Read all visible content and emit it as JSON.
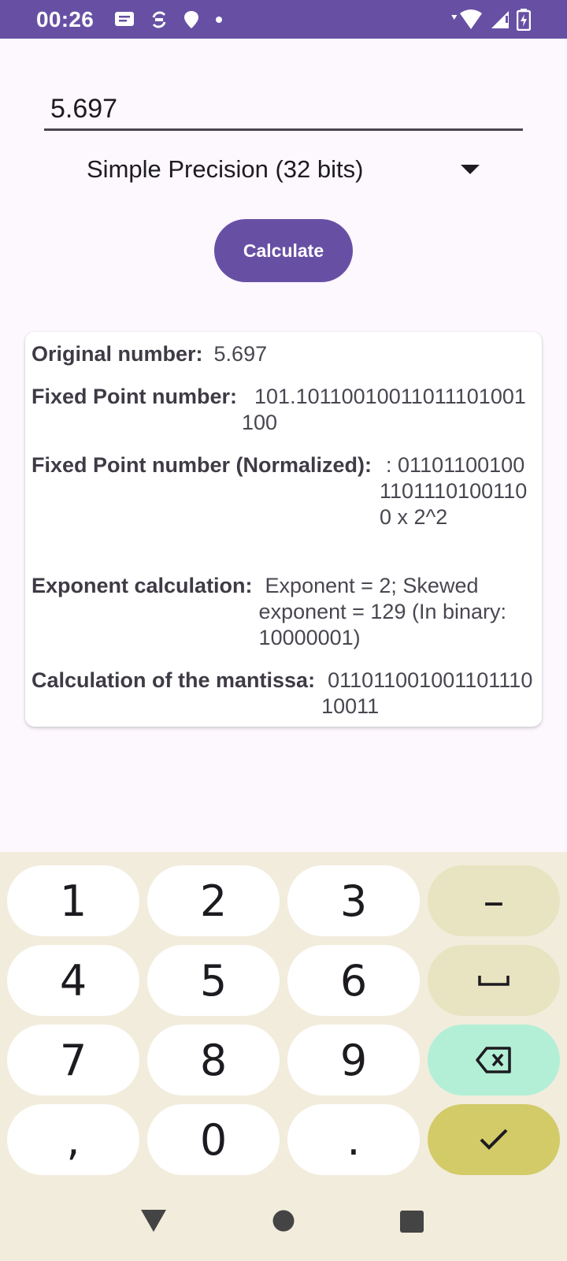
{
  "status_bar": {
    "time": "00:26",
    "left_icons": [
      "message-icon",
      "sync-icon",
      "location-icon",
      "dot-icon"
    ],
    "right_icons": [
      "wifi-icon",
      "cell-signal-icon",
      "battery-charging-icon"
    ]
  },
  "input": {
    "value": "5.697",
    "placeholder": ""
  },
  "precision": {
    "selected": "Simple Precision (32 bits)"
  },
  "calculate_button": {
    "label": "Calculate"
  },
  "results": {
    "original": {
      "label": "Original number:",
      "value": "5.697"
    },
    "fixed_point": {
      "label": "Fixed Point number:",
      "value": "101.10110010011011101001100"
    },
    "normalized": {
      "label": "Fixed Point number (Normalized):",
      "value": ": 0110110010011011101001100 x 2^2"
    },
    "exponent": {
      "label": "Exponent calculation:",
      "value": "Exponent = 2; Skewed exponent = 129 (In binary: 10000001)"
    },
    "mantissa": {
      "label": "Calculation of the mantissa:",
      "value": "01101100100110111010011"
    }
  },
  "keyboard": {
    "rows": [
      [
        "1",
        "2",
        "3",
        "–"
      ],
      [
        "4",
        "5",
        "6",
        "␣"
      ],
      [
        "7",
        "8",
        "9",
        "backspace"
      ],
      [
        ",",
        "0",
        ".",
        "done"
      ]
    ],
    "colors": {
      "background": "#f2ecdc",
      "digit_key": "#ffffff",
      "function_key": "#e8e3c0",
      "backspace_key": "#b2efd6",
      "done_key": "#d2cb68"
    }
  },
  "nav_bar": {
    "buttons": [
      "back-icon",
      "home-icon",
      "recents-icon"
    ]
  },
  "colors": {
    "accent": "#6750a4",
    "background": "#fdf7fe",
    "card": "#ffffff"
  }
}
